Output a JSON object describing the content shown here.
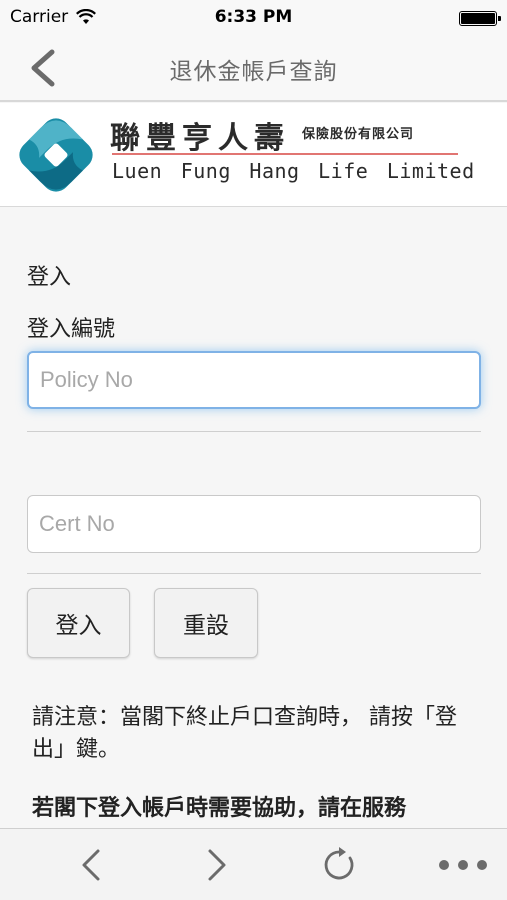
{
  "status_bar": {
    "carrier": "Carrier",
    "time": "6:33 PM",
    "battery_level": 1.0
  },
  "nav": {
    "title": "退休金帳戶查詢",
    "back_icon": "chevron-left-icon"
  },
  "logo": {
    "chinese_name": "聯豐亨人壽",
    "chinese_suffix": "保險股份有限公司",
    "english_name": "Luen Fung Hang Life Limited",
    "colors": [
      "#1a8da6",
      "#0f6f8c",
      "#d9534f"
    ]
  },
  "form": {
    "section_title": "登入",
    "login_label": "登入編號",
    "policy_input": {
      "value": "",
      "placeholder": "Policy No"
    },
    "cert_input": {
      "value": "",
      "placeholder": "Cert No"
    },
    "login_button": "登入",
    "reset_button": "重設"
  },
  "notice": "請注意：當閣下終止戶口查詢時， 請按「登出」鍵。",
  "help_text": "若閣下登入帳戶時需要協助，請在服務",
  "toolbar": {
    "icons": [
      "back-arrow-icon",
      "forward-arrow-icon",
      "reload-icon",
      "more-icon"
    ]
  }
}
